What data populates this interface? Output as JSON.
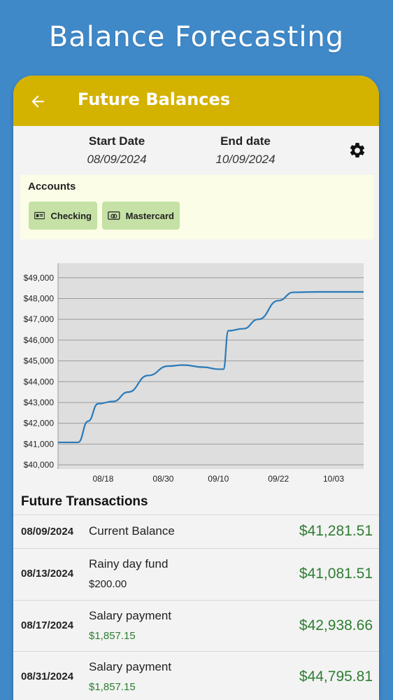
{
  "hero_title": "Balance Forecasting",
  "appbar": {
    "title": "Future Balances"
  },
  "dates": {
    "start_label": "Start Date",
    "start_value": "08/09/2024",
    "end_label": "End date",
    "end_value": "10/09/2024"
  },
  "accounts": {
    "title": "Accounts",
    "items": [
      {
        "label": "Checking",
        "icon": "id-card-icon"
      },
      {
        "label": "Mastercard",
        "icon": "credit-card-icon"
      }
    ]
  },
  "chart_data": {
    "type": "line",
    "title": "",
    "xlabel": "",
    "ylabel": "",
    "x_tick_labels": [
      "08/18",
      "08/30",
      "09/10",
      "09/22",
      "10/03"
    ],
    "y_tick_labels": [
      "$40,000",
      "$41,000",
      "$42,000",
      "$43,000",
      "$44,000",
      "$45,000",
      "$46,000",
      "$47,000",
      "$48,000",
      "$49,000"
    ],
    "ylim": [
      39800,
      49700
    ],
    "xlim": [
      "08/09",
      "10/09"
    ],
    "grid": true,
    "series": [
      {
        "color": "#2a7ab8",
        "points": [
          [
            "08/09",
            41082
          ],
          [
            "08/12",
            41082
          ],
          [
            "08/13",
            41082
          ],
          [
            "08/15",
            42100
          ],
          [
            "08/17",
            42939
          ],
          [
            "08/20",
            43050
          ],
          [
            "08/23",
            43500
          ],
          [
            "08/27",
            44300
          ],
          [
            "08/31",
            44750
          ],
          [
            "09/03",
            44800
          ],
          [
            "09/07",
            44700
          ],
          [
            "09/10",
            44600
          ],
          [
            "09/11",
            44600
          ],
          [
            "09/12",
            46450
          ],
          [
            "09/15",
            46550
          ],
          [
            "09/18",
            47000
          ],
          [
            "09/22",
            47900
          ],
          [
            "09/25",
            48300
          ],
          [
            "09/30",
            48320
          ],
          [
            "10/09",
            48320
          ]
        ]
      }
    ]
  },
  "transactions_title": "Future Transactions",
  "transactions": [
    {
      "date": "08/09/2024",
      "name": "Current Balance",
      "amount": "",
      "balance": "$41,281.51"
    },
    {
      "date": "08/13/2024",
      "name": "Rainy day fund",
      "amount": "$200.00",
      "balance": "$41,081.51"
    },
    {
      "date": "08/17/2024",
      "name": "Salary payment",
      "amount": "$1,857.15",
      "balance": "$42,938.66"
    },
    {
      "date": "08/31/2024",
      "name": "Salary payment",
      "amount": "$1,857.15",
      "balance": "$44,795.81"
    }
  ],
  "colors": {
    "background": "#3f89c9",
    "appbar": "#d4b200",
    "chip": "#c5e1a5",
    "income": "#2e7d32",
    "expense": "#222222",
    "line": "#2a7ab8"
  }
}
